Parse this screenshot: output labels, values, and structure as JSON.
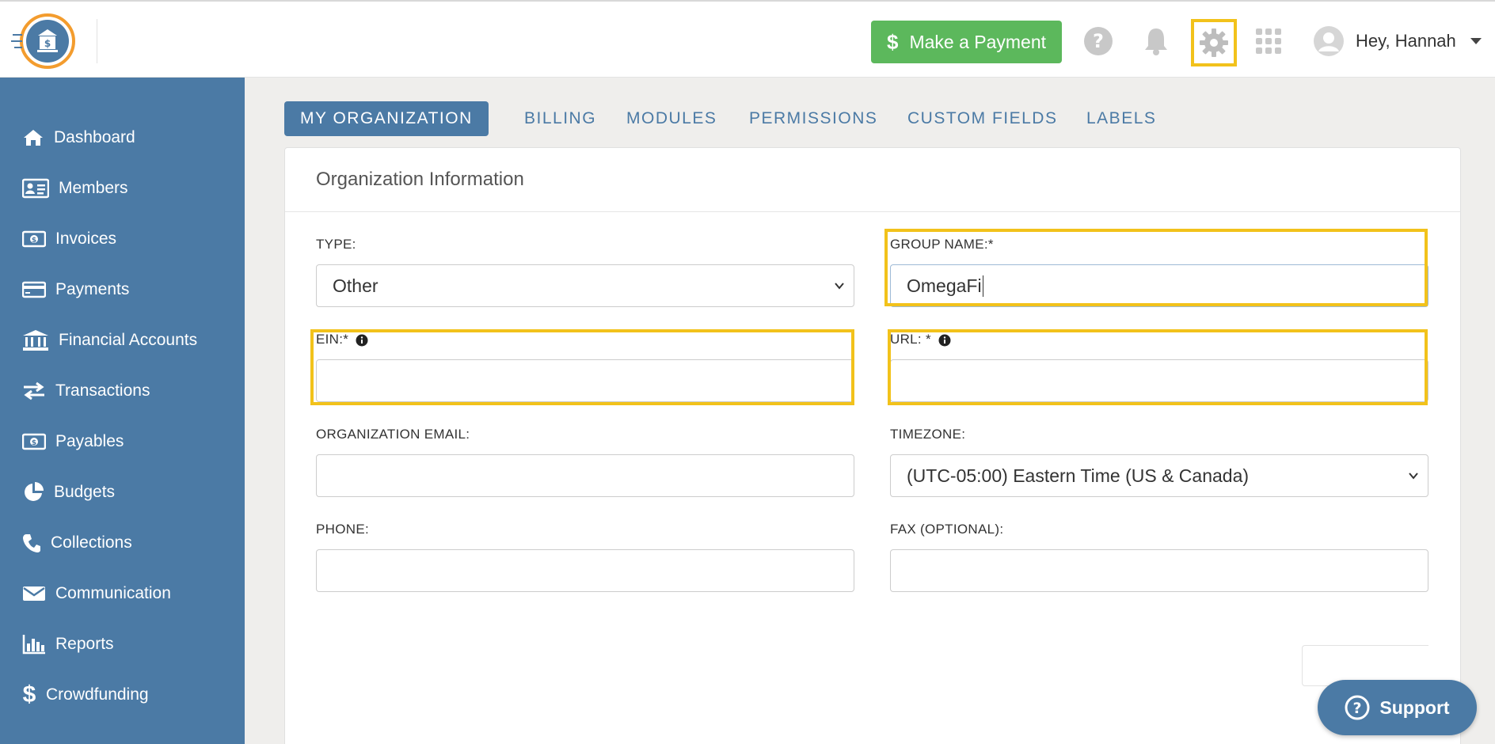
{
  "header": {
    "pay_button": "Make a Payment",
    "greeting": "Hey, Hannah"
  },
  "sidebar": {
    "items": [
      {
        "label": "Dashboard",
        "icon": "home-icon"
      },
      {
        "label": "Members",
        "icon": "id-card-icon"
      },
      {
        "label": "Invoices",
        "icon": "money-bill-icon"
      },
      {
        "label": "Payments",
        "icon": "credit-card-icon"
      },
      {
        "label": "Financial Accounts",
        "icon": "bank-icon"
      },
      {
        "label": "Transactions",
        "icon": "exchange-icon"
      },
      {
        "label": "Payables",
        "icon": "money-bill-icon"
      },
      {
        "label": "Budgets",
        "icon": "pie-chart-icon"
      },
      {
        "label": "Collections",
        "icon": "phone-icon"
      },
      {
        "label": "Communication",
        "icon": "envelope-icon"
      },
      {
        "label": "Reports",
        "icon": "bar-chart-icon"
      },
      {
        "label": "Crowdfunding",
        "icon": "dollar-icon"
      }
    ]
  },
  "tabs": [
    "MY ORGANIZATION",
    "BILLING",
    "MODULES",
    "PERMISSIONS",
    "CUSTOM FIELDS",
    "LABELS"
  ],
  "form": {
    "title": "Organization Information",
    "type_label": "TYPE:",
    "type_value": "Other",
    "group_name_label": "GROUP NAME:*",
    "group_name_value": "OmegaFi",
    "ein_label": "EIN:*",
    "ein_value": "",
    "url_label": "URL: *",
    "url_value": "",
    "org_email_label": "ORGANIZATION EMAIL:",
    "org_email_value": "",
    "timezone_label": "TIMEZONE:",
    "timezone_value": "(UTC-05:00) Eastern Time (US & Canada)",
    "phone_label": "PHONE:",
    "phone_value": "",
    "fax_label": "FAX (OPTIONAL):",
    "fax_value": ""
  },
  "support_label": "Support",
  "colors": {
    "sidebar": "#4b7aa5",
    "pay_button": "#5cb85c",
    "highlight": "#f2c21b"
  }
}
